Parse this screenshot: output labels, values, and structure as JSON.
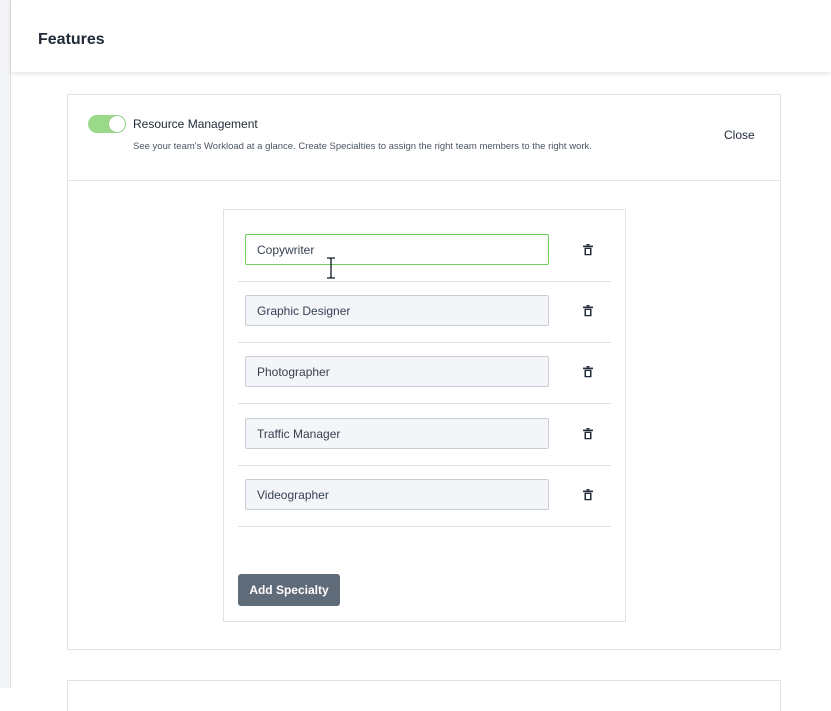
{
  "header": {
    "title": "Features"
  },
  "feature": {
    "enabled": true,
    "title": "Resource Management",
    "description": "See your team's Workload at a glance. Create Specialties to assign the right team members to the right work.",
    "close_label": "Close",
    "toggle_color": "#9ad98a"
  },
  "specialties": {
    "items": [
      {
        "value": "Copywriter",
        "active": true
      },
      {
        "value": "Graphic Designer",
        "active": false
      },
      {
        "value": "Photographer",
        "active": false
      },
      {
        "value": "Traffic Manager",
        "active": false
      },
      {
        "value": "Videographer",
        "active": false
      }
    ],
    "delete_icon": "trash-icon",
    "add_label": "Add Specialty",
    "add_button_color": "#5f6b78",
    "active_border_color": "#6fcf5b"
  }
}
